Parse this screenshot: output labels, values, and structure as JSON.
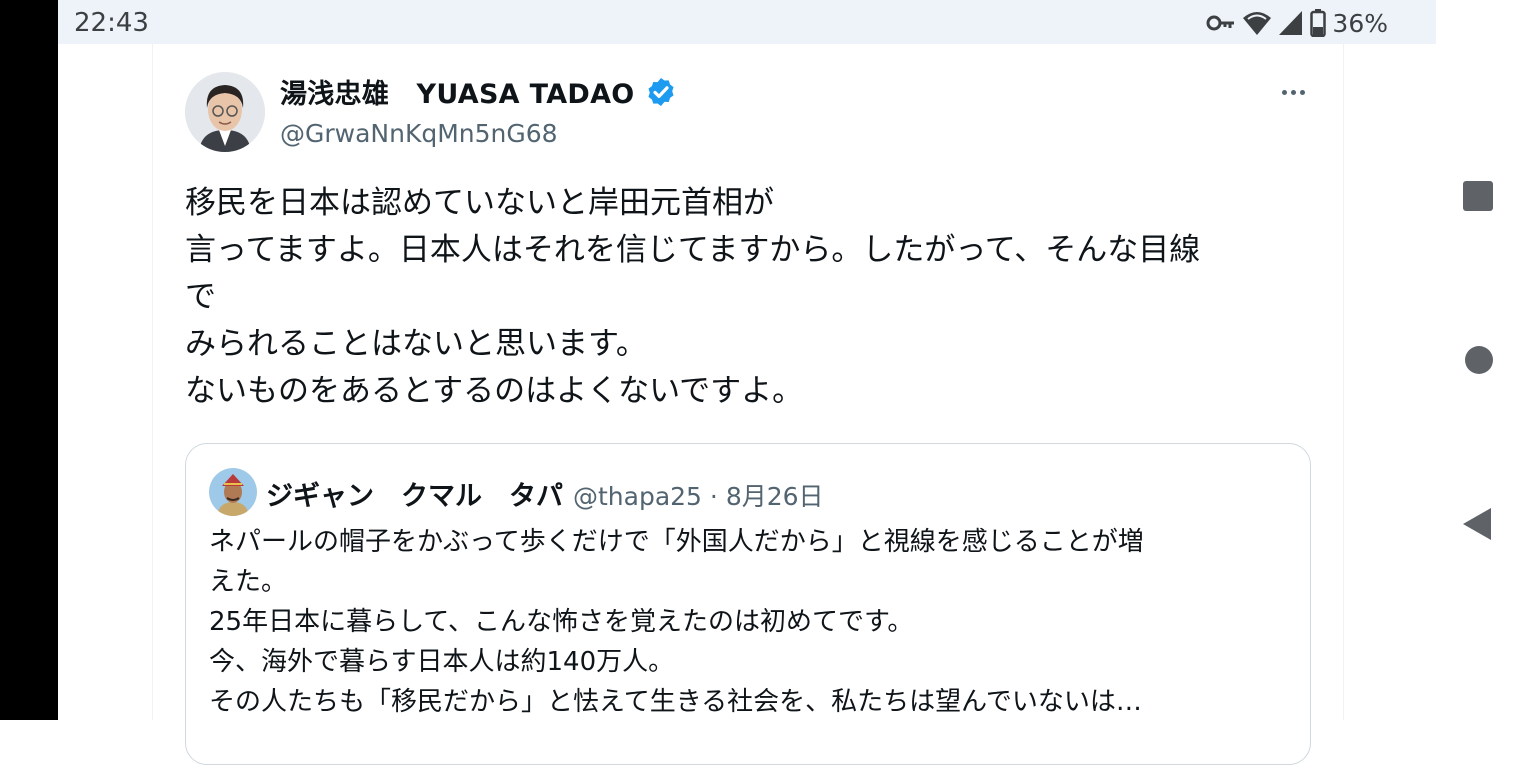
{
  "status_bar": {
    "time": "22:43",
    "battery": "36%"
  },
  "tweet": {
    "display_name": "湯浅忠雄　YUASA TADAO",
    "handle": "@GrwaNnKqMn5nG68",
    "verified": true,
    "lines": [
      "移民を日本は認めていないと岸田元首相が",
      "言ってますよ。日本人はそれを信じてますから。したがって、そんな目線",
      "で",
      "みられることはないと思います。",
      "ないものをあるとするのはよくないですよ。"
    ]
  },
  "quote": {
    "display_name": "ジギャン　クマル　タパ",
    "handle": "@thapa25",
    "separator": " · ",
    "date": "8月26日",
    "lines": [
      "ネパールの帽子をかぶって歩くだけで「外国人だから」と視線を感じることが増",
      "えた。",
      "25年日本に暮らして、こんな怖さを覚えたのは初めてです。",
      "今、海外で暮らす日本人は約140万人。",
      "その人たちも「移民だから」と怯えて生きる社会を、私たちは望んでいないは…"
    ]
  },
  "icons": {
    "key": "vpn-key-icon",
    "wifi": "wifi-icon",
    "signal": "signal-icon",
    "battery": "battery-icon",
    "verified": "verified-badge-icon",
    "more": "more-icon",
    "recents": "square-recents-icon",
    "home": "circle-home-icon",
    "back": "triangle-back-icon"
  },
  "colors": {
    "verified": "#1d9bf0",
    "text": "#0f1419",
    "secondary": "#536471",
    "border": "#cfd9de",
    "status_bg": "#eef3f9"
  }
}
